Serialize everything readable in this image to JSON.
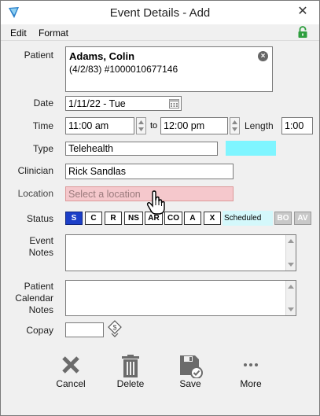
{
  "window": {
    "title": "Event Details - Add",
    "close_glyph": "✕"
  },
  "menu": {
    "items": [
      "Edit",
      "Format"
    ]
  },
  "patient": {
    "label": "Patient",
    "name": "Adams, Colin",
    "details": "(4/2/83) #1000010677146"
  },
  "date": {
    "label": "Date",
    "value": "1/11/22 - Tue"
  },
  "time": {
    "label": "Time",
    "start": "11:00 am",
    "to": "to",
    "end": "12:00 pm",
    "length_label": "Length",
    "length": "1:00"
  },
  "type": {
    "label": "Type",
    "value": "Telehealth",
    "color": "#7ff5ff"
  },
  "clinician": {
    "label": "Clinician",
    "value": "Rick Sandlas"
  },
  "location": {
    "label": "Location",
    "placeholder": "Select a location",
    "bg_color": "#f5c8cc"
  },
  "status": {
    "label": "Status",
    "buttons": [
      "S",
      "C",
      "R",
      "NS",
      "AR",
      "CO",
      "A",
      "X"
    ],
    "active": "S",
    "text": "Scheduled",
    "extra_buttons": [
      "BO",
      "AV"
    ],
    "active_color": "#1c3fc8"
  },
  "event_notes": {
    "label_line1": "Event",
    "label_line2": "Notes",
    "value": ""
  },
  "patient_calendar_notes": {
    "label_line1": "Patient",
    "label_line2": "Calendar",
    "label_line3": "Notes",
    "value": ""
  },
  "copay": {
    "label": "Copay",
    "value": ""
  },
  "actions": {
    "cancel": "Cancel",
    "delete": "Delete",
    "save": "Save",
    "more": "More"
  },
  "icons": [
    "app-icon",
    "close-icon",
    "lock-icon",
    "calendar-icon",
    "spin-up-icon",
    "spin-down-icon",
    "copay-icon",
    "cancel-icon",
    "delete-icon",
    "save-icon",
    "more-icon",
    "hand-cursor-icon"
  ]
}
